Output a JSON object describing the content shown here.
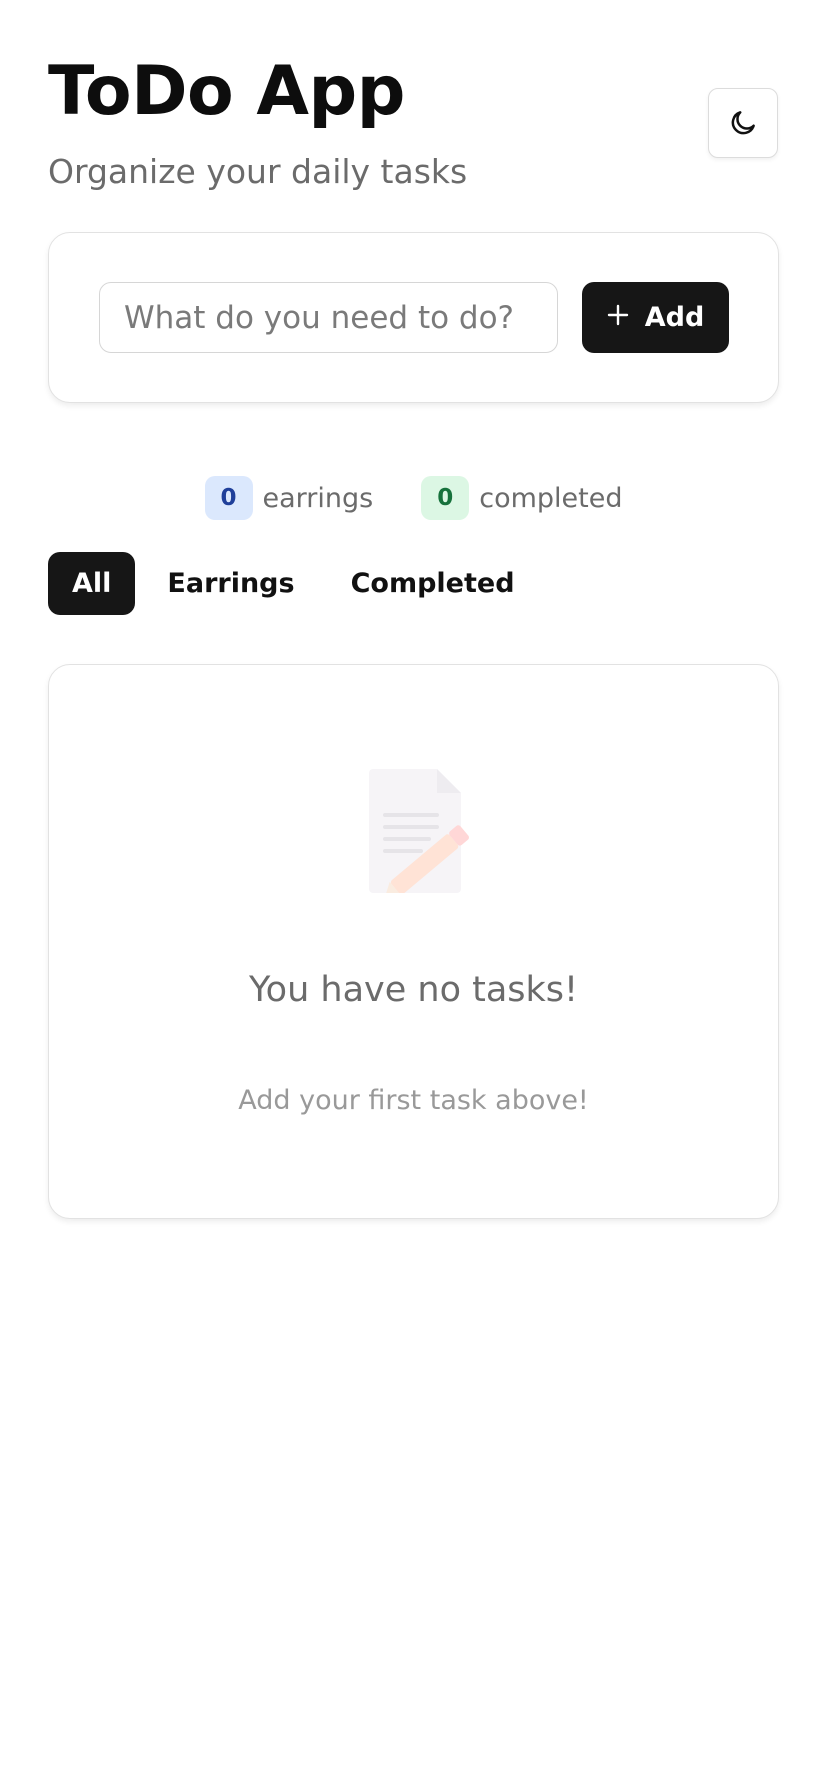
{
  "header": {
    "title": "ToDo App",
    "subtitle": "Organize your daily tasks",
    "theme_toggle_icon": "moon-icon"
  },
  "add_form": {
    "input_value": "",
    "input_placeholder": "What do you need to do?",
    "add_button_icon": "plus-icon",
    "add_button_label": "Add"
  },
  "stats": {
    "earrings_count": "0",
    "earrings_label": "earrings",
    "completed_count": "0",
    "completed_label": "completed"
  },
  "tabs": [
    {
      "label": "All",
      "active": true
    },
    {
      "label": "Earrings",
      "active": false
    },
    {
      "label": "Completed",
      "active": false
    }
  ],
  "empty_state": {
    "icon": "memo-icon",
    "title": "You have no tasks!",
    "subtitle": "Add your first task above!"
  },
  "colors": {
    "primary": "#161616",
    "earrings_badge_bg": "#dbe8fd",
    "earrings_badge_text": "#1f3f9a",
    "completed_badge_bg": "#dcf7e4",
    "completed_badge_text": "#17723c"
  }
}
